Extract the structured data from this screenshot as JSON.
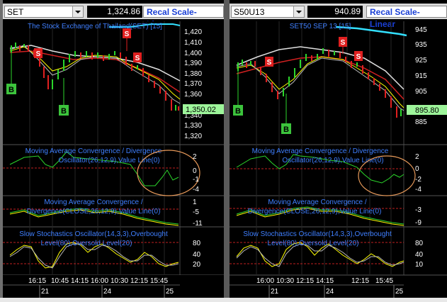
{
  "left": {
    "symbol": "SET",
    "price": "1,324.86",
    "recal": "Recal Scale-Linear",
    "chart_title": "The Stock Exchange of Thailand(SET) [15]",
    "price_labels": [
      "1,420",
      "1,410",
      "1,400",
      "1,390",
      "1,380",
      "1,370",
      "1,360",
      "1,340",
      "1,330",
      "1,320"
    ],
    "last_price": "1,350.02",
    "macd_title_1": "Moving Average Convergence / Divergence",
    "macd_title_2": "Oscillator(26,12,9),Value Line(0)",
    "macd_labels": [
      "2",
      "0",
      "-1",
      "-4"
    ],
    "div_title_1": "Moving Average Convergence /",
    "div_title_2": "Divergence(CLOSE,26,12,9),Value Line(0)",
    "div_labels": [
      "1",
      "-5",
      "-11"
    ],
    "stoch_title_1": "Slow Stochastics Oscillator(14,3,3),Overbought",
    "stoch_title_2": "Level(80),Oversold Level(20)",
    "stoch_labels": [
      "80",
      "40",
      "20"
    ],
    "time_labels": [
      "16:15",
      "10:45",
      "14:15",
      "16:00",
      "10:30",
      "12:15",
      "15:45"
    ],
    "day_labels": [
      "21",
      "24",
      "25"
    ],
    "markers": {
      "buy": "B",
      "sell": "S"
    }
  },
  "right": {
    "symbol": "S50U13",
    "price": "940.89",
    "recal": "Recal Scale-Linear",
    "chart_title": "SET50 SEP 13 [15]",
    "price_labels": [
      "945",
      "935",
      "925",
      "915",
      "905",
      "885"
    ],
    "last_price": "895.80",
    "macd_title_1": "Moving Average Convergence / Divergence",
    "macd_title_2": "Oscillator(26,12,9),Value Line(0)",
    "macd_labels": [
      "2",
      "0",
      "-2",
      "-4"
    ],
    "div_title_1": "Moving Average Convergence /",
    "div_title_2": "Divergence(CLOSE,26,12,9),Value Line(0)",
    "div_labels": [
      "-3",
      "-9"
    ],
    "stoch_title_1": "Slow Stochastics Oscillator(14,3,3),Overbought",
    "stoch_title_2": "Level(80),Oversold Level(20)",
    "stoch_labels": [
      "80",
      "40",
      "10"
    ],
    "time_labels": [
      "16:00",
      "10:30",
      "12:15",
      "14:15",
      "12:15",
      "15:45"
    ],
    "day_labels": [
      "21",
      "24",
      "25"
    ],
    "markers": {
      "buy": "B",
      "sell": "S"
    }
  },
  "colors": {
    "recal_text": "#1a3fd6",
    "title_text": "#3f7fff",
    "grid": "#2a2a2a",
    "dash_red": "#c02020",
    "last_price_bg": "#9df59a",
    "signal_sell": "#e02020",
    "signal_buy": "#3cc43c"
  }
}
